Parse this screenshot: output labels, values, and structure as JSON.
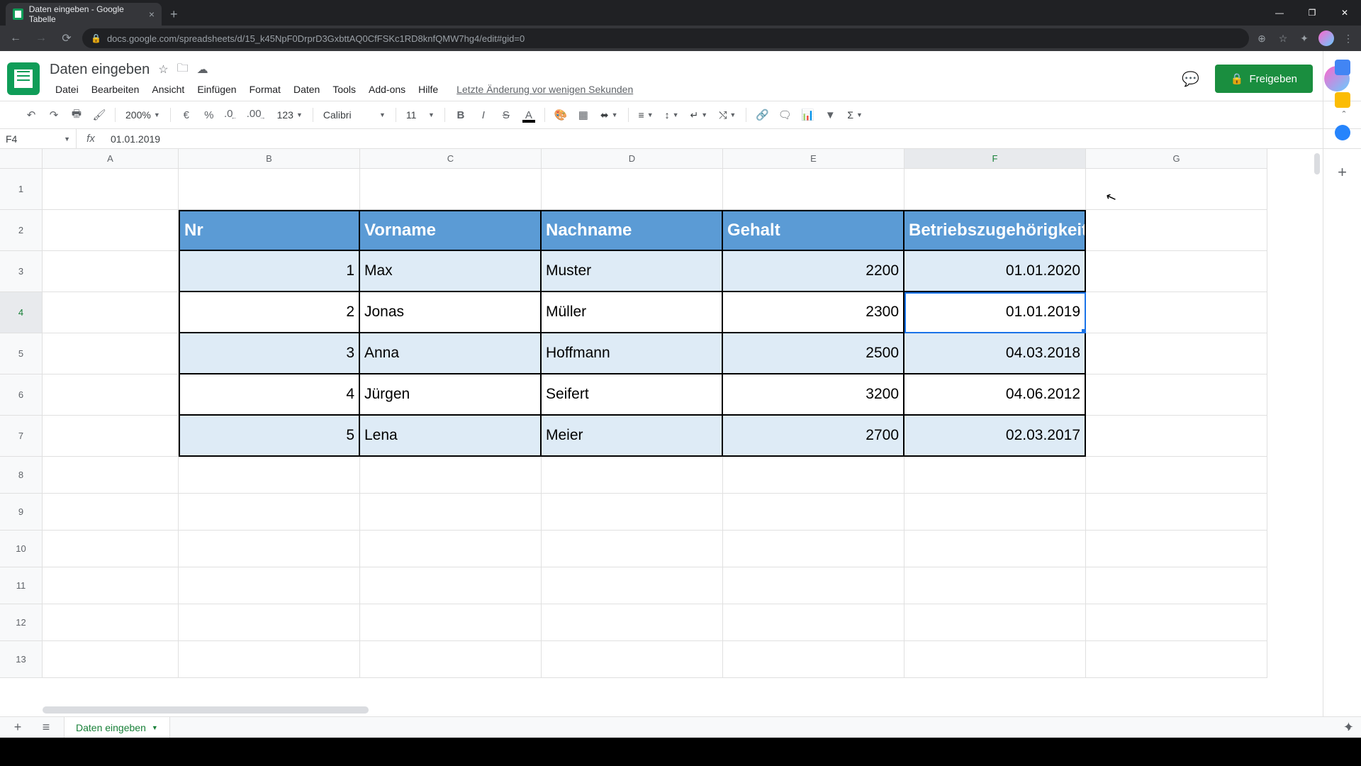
{
  "browser": {
    "tab_title": "Daten eingeben - Google Tabelle",
    "url": "docs.google.com/spreadsheets/d/15_k45NpF0DrprD3GxbttAQ0CfFSKc1RD8knfQMW7hg4/edit#gid=0"
  },
  "doc": {
    "title": "Daten eingeben",
    "menus": [
      "Datei",
      "Bearbeiten",
      "Ansicht",
      "Einfügen",
      "Format",
      "Daten",
      "Tools",
      "Add-ons",
      "Hilfe"
    ],
    "last_edit": "Letzte Änderung vor wenigen Sekunden",
    "share_label": "Freigeben"
  },
  "toolbar": {
    "zoom": "200%",
    "currency": "€",
    "percent": "%",
    "dec_dec": ".0",
    "dec_inc": ".00",
    "more_formats": "123",
    "font": "Calibri",
    "size": "11"
  },
  "namebox": "F4",
  "formula": "01.01.2019",
  "columns": [
    "A",
    "B",
    "C",
    "D",
    "E",
    "F",
    "G"
  ],
  "table": {
    "headers": [
      "Nr",
      "Vorname",
      "Nachname",
      "Gehalt",
      "Betriebszugehörigkeit"
    ],
    "rows": [
      {
        "nr": "1",
        "vor": "Max",
        "nach": "Muster",
        "geh": "2200",
        "datum": "01.01.2020"
      },
      {
        "nr": "2",
        "vor": "Jonas",
        "nach": "Müller",
        "geh": "2300",
        "datum": "01.01.2019"
      },
      {
        "nr": "3",
        "vor": "Anna",
        "nach": "Hoffmann",
        "geh": "2500",
        "datum": "04.03.2018"
      },
      {
        "nr": "4",
        "vor": "Jürgen",
        "nach": "Seifert",
        "geh": "3200",
        "datum": "04.06.2012"
      },
      {
        "nr": "5",
        "vor": "Lena",
        "nach": "Meier",
        "geh": "2700",
        "datum": "02.03.2017"
      }
    ]
  },
  "sheet_tab": "Daten eingeben"
}
